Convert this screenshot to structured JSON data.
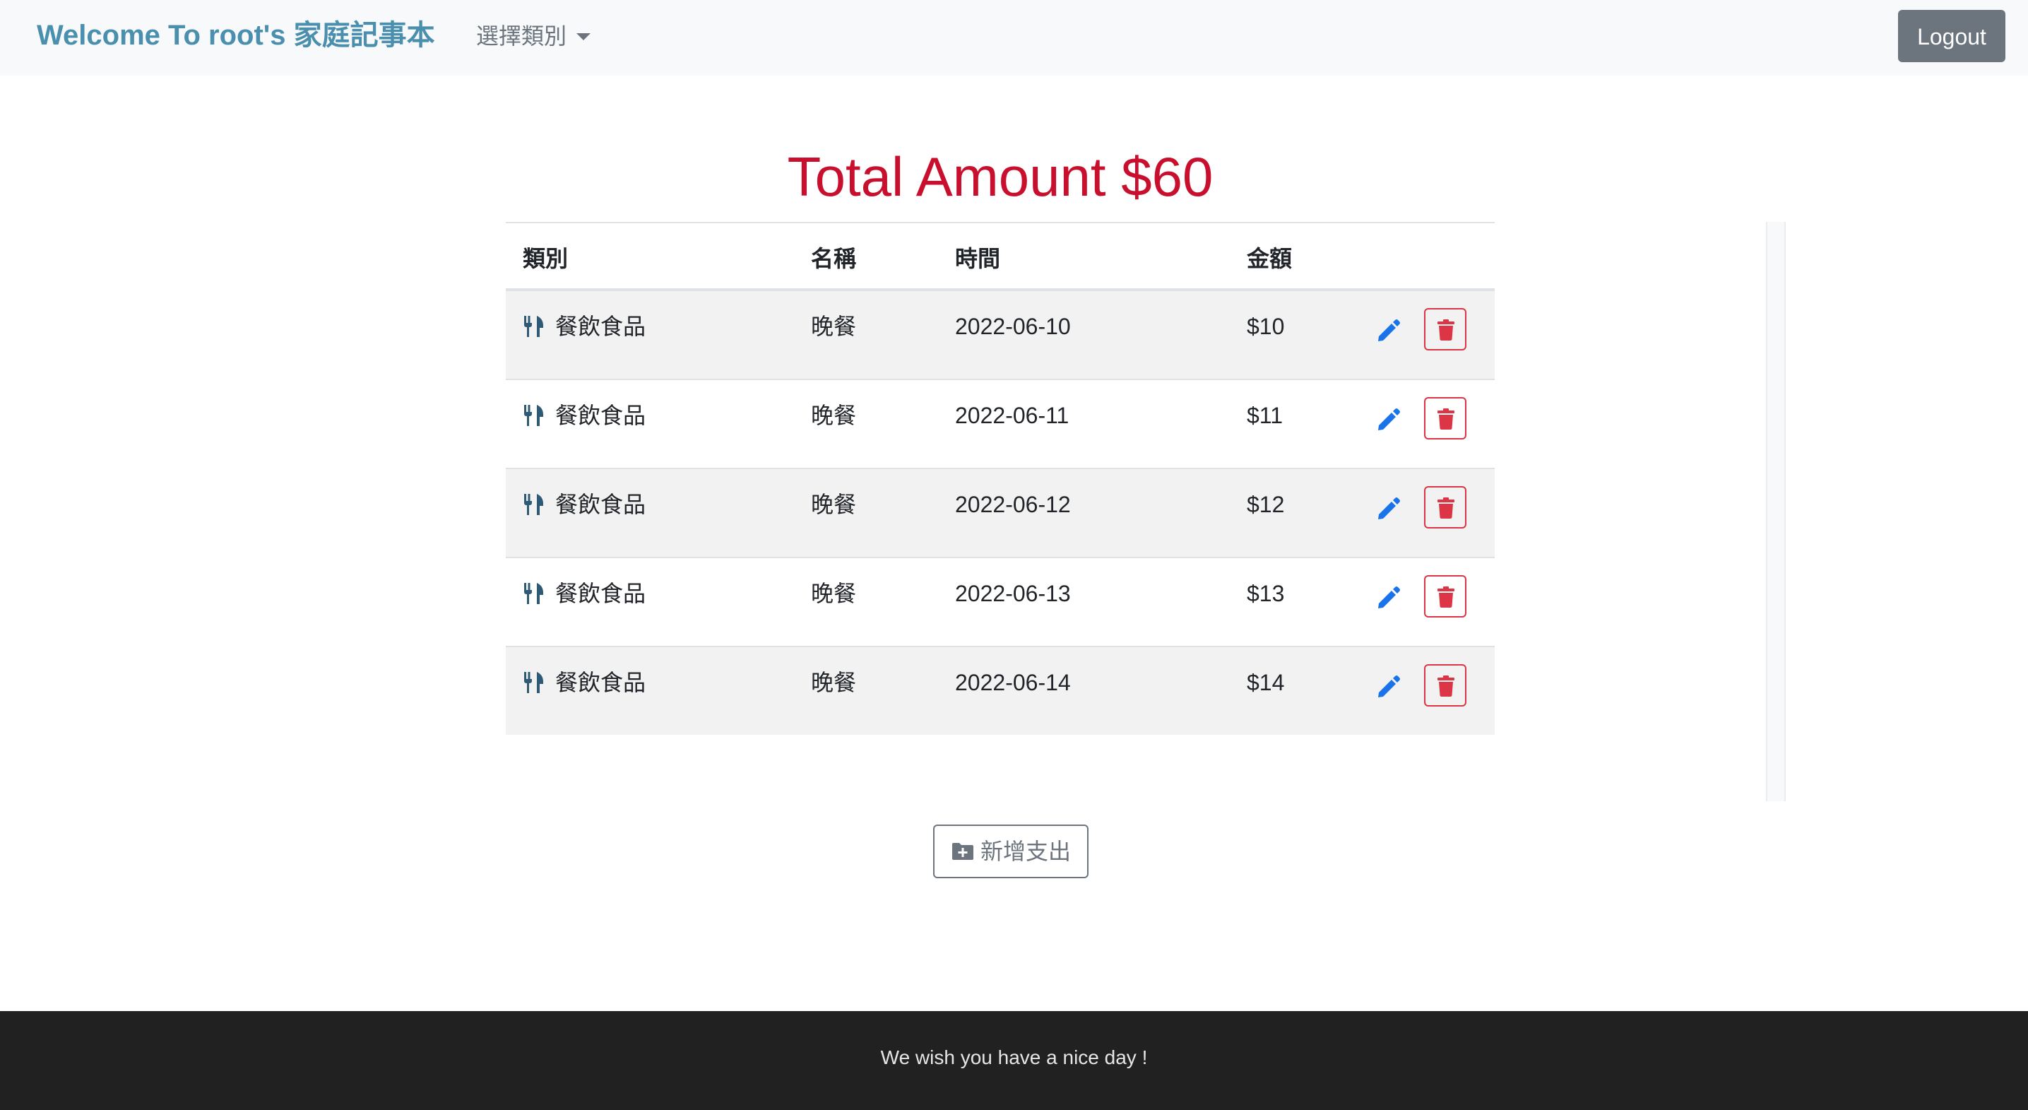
{
  "navbar": {
    "brand": "Welcome To root's 家庭記事本",
    "category_dropdown": "選擇類別",
    "logout_label": "Logout"
  },
  "title": {
    "prefix": "Total Amount",
    "amount": "$60"
  },
  "table": {
    "headers": [
      "類別",
      "名稱",
      "時間",
      "金額"
    ],
    "rows": [
      {
        "category": "餐飲食品",
        "category_icon": "utensils-icon",
        "name": "晚餐",
        "date": "2022-06-10",
        "amount": "$10"
      },
      {
        "category": "餐飲食品",
        "category_icon": "utensils-icon",
        "name": "晚餐",
        "date": "2022-06-11",
        "amount": "$11"
      },
      {
        "category": "餐飲食品",
        "category_icon": "utensils-icon",
        "name": "晚餐",
        "date": "2022-06-12",
        "amount": "$12"
      },
      {
        "category": "餐飲食品",
        "category_icon": "utensils-icon",
        "name": "晚餐",
        "date": "2022-06-13",
        "amount": "$13"
      },
      {
        "category": "餐飲食品",
        "category_icon": "utensils-icon",
        "name": "晚餐",
        "date": "2022-06-14",
        "amount": "$14"
      }
    ],
    "row_actions": [
      "pencil-icon",
      "trash-icon"
    ]
  },
  "add_button": {
    "icon": "folder-plus-icon",
    "label": "新增支出"
  },
  "footer": {
    "text": "We wish you have a nice day !"
  },
  "colors": {
    "brand": "#4a8fad",
    "title": "#c8102e",
    "edit": "#1a73e8",
    "delete": "#dc3545",
    "category_icon": "#2f5a75",
    "footer_bg": "#212121"
  }
}
